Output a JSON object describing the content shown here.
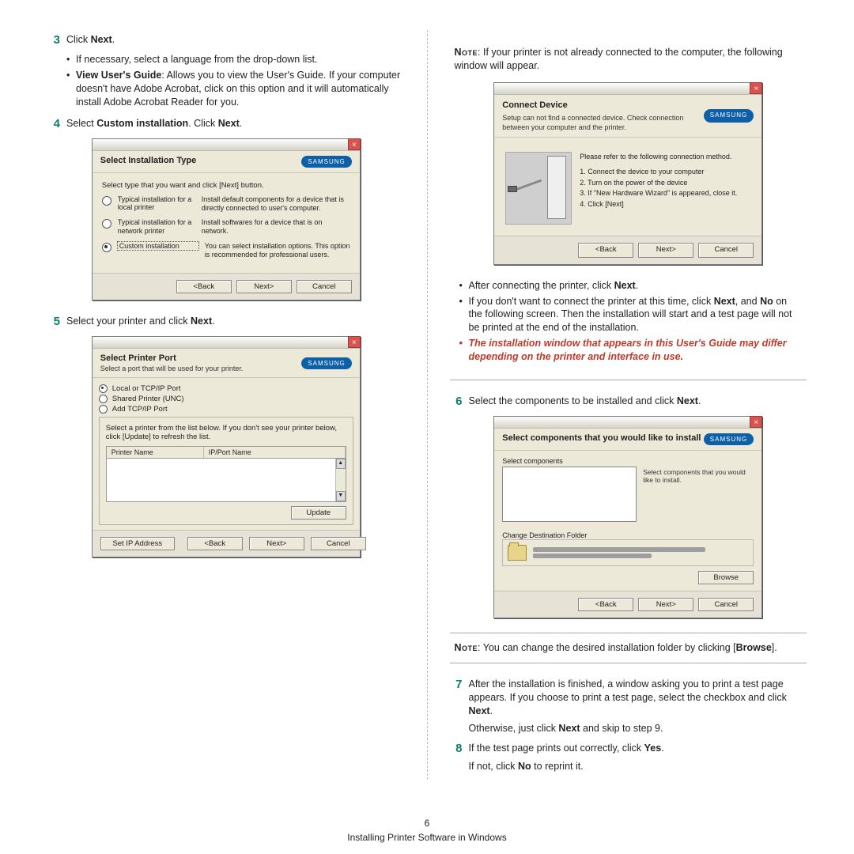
{
  "page_number": "6",
  "footer": "Installing Printer Software in Windows",
  "brand": "SAMSUNG",
  "buttons": {
    "back": "<Back",
    "next": "Next>",
    "cancel": "Cancel",
    "update": "Update",
    "setip": "Set IP Address",
    "browse": "Browse"
  },
  "left": {
    "step3": {
      "num": "3",
      "text_click": "Click ",
      "text_next": "Next",
      "text_end": ".",
      "b1": "If necessary, select a language from the drop-down list.",
      "b2_lead": "View User's Guide",
      "b2_rest": ": Allows you to view the User's Guide. If your computer doesn't have Adobe Acrobat, click on this option and it will automatically install Adobe Acrobat Reader for you."
    },
    "step4": {
      "num": "4",
      "t1": "Select ",
      "t2": "Custom installation",
      "t3": ". Click ",
      "t4": "Next",
      "t5": "."
    },
    "step5": {
      "num": "5",
      "t1": "Select your printer and click ",
      "t2": "Next",
      "t3": "."
    },
    "dlgA": {
      "title": "Select Installation Type",
      "instr": "Select type that you want and click [Next] button.",
      "r1_label": "Typical installation for a local printer",
      "r1_desc": "Install default components for a device that is directly connected to user's computer.",
      "r2_label": "Typical installation for a network printer",
      "r2_desc": "Install softwares for a device that is on network.",
      "r3_label": "Custom installation",
      "r3_desc": "You can select installation options. This option is recommended for professional users."
    },
    "dlgB": {
      "title": "Select Printer Port",
      "sub": "Select a port that will be used for your printer.",
      "opt1": "Local or TCP/IP Port",
      "opt2": "Shared Printer (UNC)",
      "opt3": "Add TCP/IP Port",
      "instr": "Select a printer from the list below. If you don't see your printer below, click [Update] to refresh the list.",
      "col1": "Printer Name",
      "col2": "IP/Port Name"
    }
  },
  "right": {
    "note1_a": "Note",
    "note1_b": ": If your printer is not already connected to the computer, the following window will appear.",
    "dlgC": {
      "title": "Connect Device",
      "sub": "Setup can not find a connected device. Check connection between your computer and the printer.",
      "lead": "Please refer to the following connection method.",
      "s1": "1. Connect the device to your computer",
      "s2": "2. Turn on the power of the device",
      "s3": "3. If \"New Hardware Wizard\" is appeared, close it.",
      "s4": "4. Click [Next]"
    },
    "ul1": {
      "a1": "After connecting the printer, click ",
      "a2": "Next",
      "a3": ".",
      "b1": "If you don't want to connect the printer at this time, click ",
      "b2": "Next",
      "b3": ", and ",
      "b4": "No",
      "b5": " on the following screen. Then the installation will start and a test page will not be printed at the end of the installation.",
      "c": "The installation window that appears in this User's Guide may differ depending on the printer and interface in use."
    },
    "step6": {
      "num": "6",
      "t1": "Select the components to be installed and click ",
      "t2": "Next",
      "t3": "."
    },
    "dlgD": {
      "title": "Select components that you would like to install",
      "cap": "Select components",
      "hint": "Select components that you would like to install.",
      "dest": "Change Destination Folder"
    },
    "note2_a": "Note",
    "note2_b": ": You can change the desired installation folder by clicking [",
    "note2_c": "Browse",
    "note2_d": "].",
    "step7": {
      "num": "7",
      "t1": "After the installation is finished, a window asking you to print a test page appears. If you choose to print a test page, select the checkbox and click ",
      "t2": "Next",
      "t3": ".",
      "t4": "Otherwise, just click ",
      "t5": "Next",
      "t6": " and skip to step 9."
    },
    "step8": {
      "num": "8",
      "t1": "If the test page prints out correctly, click ",
      "t2": "Yes",
      "t3": ".",
      "t4": "If not, click ",
      "t5": "No",
      "t6": " to reprint it."
    }
  }
}
